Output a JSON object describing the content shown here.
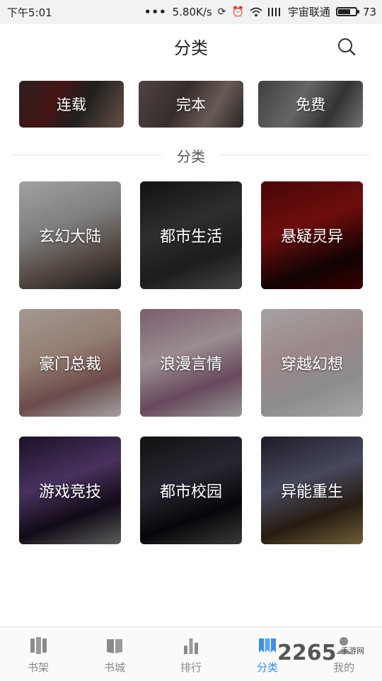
{
  "status_bar": {
    "time": "下午5:01",
    "dots": "•••",
    "speed": "5.80K/s",
    "carrier": "宇宙联通",
    "battery": "73",
    "battery_level": 0.73
  },
  "header": {
    "title": "分类",
    "search_icon": "search-icon"
  },
  "quick_filters": [
    {
      "label": "连载"
    },
    {
      "label": "完本"
    },
    {
      "label": "免费"
    }
  ],
  "section": {
    "title": "分类"
  },
  "categories": [
    {
      "label": "玄幻大陆"
    },
    {
      "label": "都市生活"
    },
    {
      "label": "悬疑灵异"
    },
    {
      "label": "豪门总裁"
    },
    {
      "label": "浪漫言情"
    },
    {
      "label": "穿越幻想"
    },
    {
      "label": "游戏竞技"
    },
    {
      "label": "都市校园"
    },
    {
      "label": "异能重生"
    }
  ],
  "bottom_nav": {
    "items": [
      {
        "label": "书架",
        "icon": "bookshelf-icon"
      },
      {
        "label": "书城",
        "icon": "book-icon"
      },
      {
        "label": "排行",
        "icon": "ranking-icon"
      },
      {
        "label": "分类",
        "icon": "category-icon",
        "active": true
      },
      {
        "label": "我的",
        "icon": "profile-icon"
      }
    ],
    "active_color": "#3a8ee6",
    "inactive_color": "#888888"
  },
  "watermark": {
    "text": "2265",
    "sub": "手游网"
  }
}
